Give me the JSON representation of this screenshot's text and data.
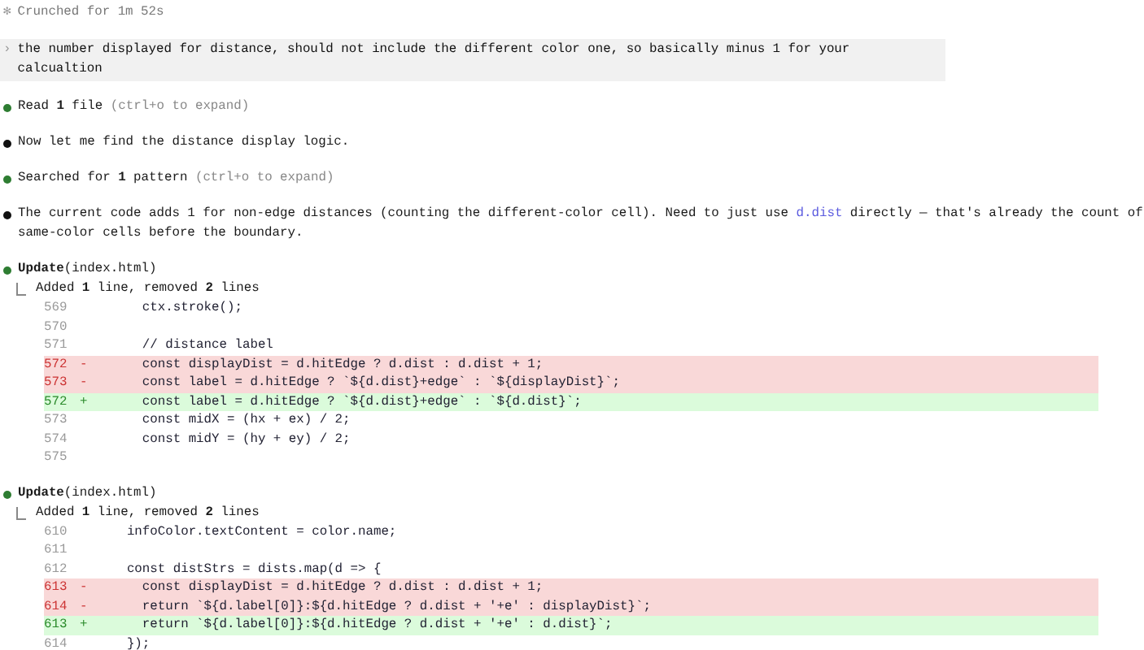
{
  "entries": [
    {
      "kind": "status",
      "icon": "✻",
      "text": "Crunched for 1m 52s"
    },
    {
      "kind": "prompt",
      "icon": "›",
      "text": "the number displayed for distance, should not include the different color one, so basically minus 1 for your calcualtion"
    },
    {
      "kind": "tool",
      "text": "Read **1** file",
      "hint": "(ctrl+o to expand)"
    },
    {
      "kind": "message",
      "segments": [
        {
          "kind": "text",
          "text": "Now let me find the distance display logic."
        }
      ]
    },
    {
      "kind": "tool",
      "text": "Searched for **1** pattern",
      "hint": "(ctrl+o to expand)"
    },
    {
      "kind": "message",
      "segments": [
        {
          "kind": "text",
          "text": "The current code adds 1 for non-edge distances (counting the different-color cell). Need to just use "
        },
        {
          "kind": "code",
          "text": "d.dist"
        },
        {
          "kind": "text",
          "text": " directly — that's already the count of same-color cells before the boundary."
        }
      ]
    },
    {
      "kind": "update",
      "title": "**Update**(index.html)",
      "summary": "Added **1** line, removed **2** lines",
      "lines": [
        {
          "kind": "context",
          "number": "569",
          "code": "      ctx.stroke();"
        },
        {
          "kind": "context",
          "number": "570"
        },
        {
          "kind": "context",
          "number": "571",
          "code": "      // distance label"
        },
        {
          "kind": "removed",
          "number": "572",
          "sign": "-",
          "code": "      const displayDist = d.hitEdge ? d.dist : d.dist + 1;"
        },
        {
          "kind": "removed",
          "number": "573",
          "sign": "-",
          "code": "      const label = d.hitEdge ? `${d.dist}+edge` : `${displayDist}`;"
        },
        {
          "kind": "added",
          "number": "572",
          "sign": "+",
          "code": "      const label = d.hitEdge ? `${d.dist}+edge` : `${d.dist}`;"
        },
        {
          "kind": "context",
          "number": "573",
          "code": "      const midX = (hx + ex) / 2;"
        },
        {
          "kind": "context",
          "number": "574",
          "code": "      const midY = (hy + ey) / 2;"
        },
        {
          "kind": "context",
          "number": "575"
        }
      ]
    },
    {
      "kind": "update",
      "title": "**Update**(index.html)",
      "summary": "Added **1** line, removed **2** lines",
      "lines": [
        {
          "kind": "context",
          "number": "610",
          "code": "    infoColor.textContent = color.name;"
        },
        {
          "kind": "context",
          "number": "611"
        },
        {
          "kind": "context",
          "number": "612",
          "code": "    const distStrs = dists.map(d => {"
        },
        {
          "kind": "removed",
          "number": "613",
          "sign": "-",
          "code": "      const displayDist = d.hitEdge ? d.dist : d.dist + 1;"
        },
        {
          "kind": "removed",
          "number": "614",
          "sign": "-",
          "code": "      return `${d.label[0]}:${d.hitEdge ? d.dist + '+e' : displayDist}`;"
        },
        {
          "kind": "added",
          "number": "613",
          "sign": "+",
          "code": "      return `${d.label[0]}:${d.hitEdge ? d.dist + '+e' : d.dist}`;"
        },
        {
          "kind": "context",
          "number": "614",
          "code": "    });"
        }
      ]
    }
  ]
}
